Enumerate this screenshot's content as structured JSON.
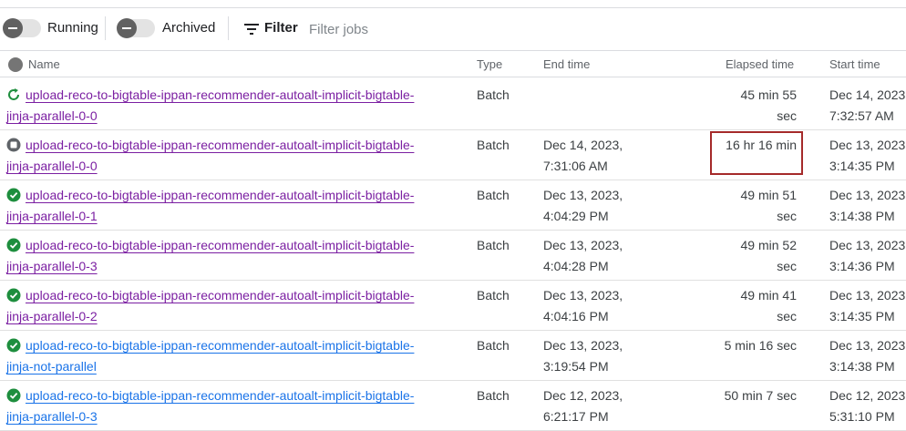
{
  "toolbar": {
    "running_label": "Running",
    "archived_label": "Archived",
    "filter_label": "Filter",
    "filter_placeholder": "Filter jobs",
    "filter_icon": "filter-lines-icon"
  },
  "columns": {
    "name": "Name",
    "type": "Type",
    "end_time": "End time",
    "elapsed_time": "Elapsed time",
    "start_time": "Start time"
  },
  "colors": {
    "visited_link": "#7b1fa2",
    "link": "#1a73e8",
    "success": "#1e8e3e",
    "stopped": "#5f6368",
    "highlight_box": "#a52a2a"
  },
  "jobs": [
    {
      "status": "running",
      "name_line1": "upload-reco-to-bigtable-ippan-recommender-autoalt-implicit-bigtable-",
      "name_line2": "jinja-parallel-0-0",
      "type": "Batch",
      "end_line1": "",
      "end_line2": "",
      "elapsed_line1": "45 min 55",
      "elapsed_line2": "sec",
      "start_line1": "Dec 14, 2023",
      "start_line2": "7:32:57 AM"
    },
    {
      "status": "stopped",
      "name_line1": "upload-reco-to-bigtable-ippan-recommender-autoalt-implicit-bigtable-",
      "name_line2": "jinja-parallel-0-0",
      "type": "Batch",
      "end_line1": "Dec 14, 2023,",
      "end_line2": "7:31:06 AM",
      "elapsed_line1": "16 hr 16 min",
      "elapsed_line2": "",
      "start_line1": "Dec 13, 2023",
      "start_line2": "3:14:35 PM"
    },
    {
      "status": "succeeded",
      "name_line1": "upload-reco-to-bigtable-ippan-recommender-autoalt-implicit-bigtable-",
      "name_line2": "jinja-parallel-0-1",
      "type": "Batch",
      "end_line1": "Dec 13, 2023,",
      "end_line2": "4:04:29 PM",
      "elapsed_line1": "49 min 51",
      "elapsed_line2": "sec",
      "start_line1": "Dec 13, 2023",
      "start_line2": "3:14:38 PM"
    },
    {
      "status": "succeeded",
      "name_line1": "upload-reco-to-bigtable-ippan-recommender-autoalt-implicit-bigtable-",
      "name_line2": "jinja-parallel-0-3",
      "type": "Batch",
      "end_line1": "Dec 13, 2023,",
      "end_line2": "4:04:28 PM",
      "elapsed_line1": "49 min 52",
      "elapsed_line2": "sec",
      "start_line1": "Dec 13, 2023",
      "start_line2": "3:14:36 PM"
    },
    {
      "status": "succeeded",
      "name_line1": "upload-reco-to-bigtable-ippan-recommender-autoalt-implicit-bigtable-",
      "name_line2": "jinja-parallel-0-2",
      "type": "Batch",
      "end_line1": "Dec 13, 2023,",
      "end_line2": "4:04:16 PM",
      "elapsed_line1": "49 min 41",
      "elapsed_line2": "sec",
      "start_line1": "Dec 13, 2023",
      "start_line2": "3:14:35 PM"
    },
    {
      "status": "succeeded",
      "name_line1": "upload-reco-to-bigtable-ippan-recommender-autoalt-implicit-bigtable-",
      "name_line2": "jinja-not-parallel",
      "type": "Batch",
      "end_line1": "Dec 13, 2023,",
      "end_line2": "3:19:54 PM",
      "elapsed_line1": "5 min 16 sec",
      "elapsed_line2": "",
      "start_line1": "Dec 13, 2023",
      "start_line2": "3:14:38 PM"
    },
    {
      "status": "succeeded",
      "name_line1": "upload-reco-to-bigtable-ippan-recommender-autoalt-implicit-bigtable-",
      "name_line2": "jinja-parallel-0-3",
      "type": "Batch",
      "end_line1": "Dec 12, 2023,",
      "end_line2": "6:21:17 PM",
      "elapsed_line1": "50 min 7 sec",
      "elapsed_line2": "",
      "start_line1": "Dec 12, 2023",
      "start_line2": "5:31:10 PM"
    }
  ]
}
